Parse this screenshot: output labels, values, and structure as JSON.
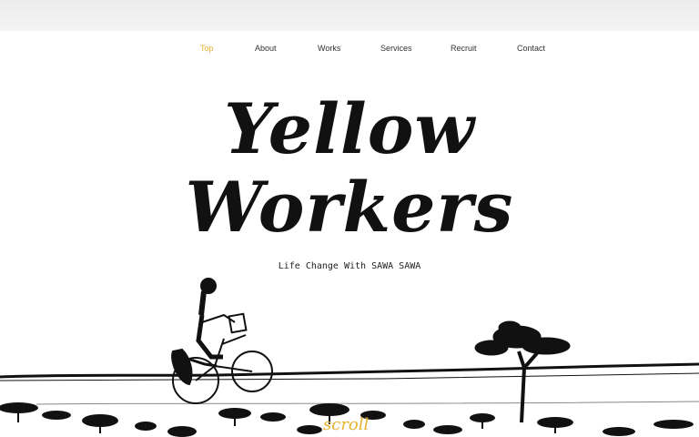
{
  "nav": {
    "items": [
      {
        "label": "Top",
        "active": true
      },
      {
        "label": "About",
        "active": false
      },
      {
        "label": "Works",
        "active": false
      },
      {
        "label": "Services",
        "active": false
      },
      {
        "label": "Recruit",
        "active": false
      },
      {
        "label": "Contact",
        "active": false
      }
    ]
  },
  "hero": {
    "title_line1": "Yellow",
    "title_line2": "Workers",
    "tagline": "Life Change With SAWA SAWA"
  },
  "scroll_label": "scroll",
  "colors": {
    "accent": "#e6b32e",
    "text": "#111111",
    "background": "#ffffff"
  },
  "illustration": {
    "subjects": [
      "cyclist-on-bicycle",
      "acacia-tree",
      "savanna-bushes"
    ]
  }
}
